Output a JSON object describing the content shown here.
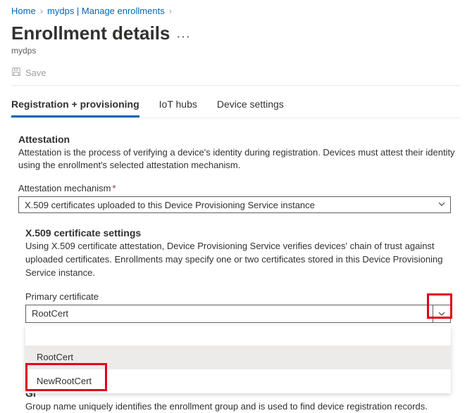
{
  "breadcrumb": {
    "home": "Home",
    "path": "mydps | Manage enrollments"
  },
  "header": {
    "title": "Enrollment details",
    "subtitle": "mydps"
  },
  "toolbar": {
    "save_label": "Save"
  },
  "tabs": {
    "t0": "Registration + provisioning",
    "t1": "IoT hubs",
    "t2": "Device settings"
  },
  "attestation": {
    "title": "Attestation",
    "desc": "Attestation is the process of verifying a device's identity during registration. Devices must attest their identity using the enrollment's selected attestation mechanism.",
    "mech_label": "Attestation mechanism",
    "mech_value": "X.509 certificates uploaded to this Device Provisioning Service instance"
  },
  "x509": {
    "title": "X.509 certificate settings",
    "desc": "Using X.509 certificate attestation, Device Provisioning Service verifies devices' chain of trust against uploaded certificates. Enrollments may specify one or two certificates stored in this Device Provisioning Service instance.",
    "primary_label": "Primary certificate",
    "primary_value": "RootCert",
    "options": {
      "opt0": "RootCert",
      "opt1": "NewRootCert"
    }
  },
  "group": {
    "title": "Gr",
    "desc": "Group name uniquely identifies the enrollment group and is used to find device registration records."
  }
}
